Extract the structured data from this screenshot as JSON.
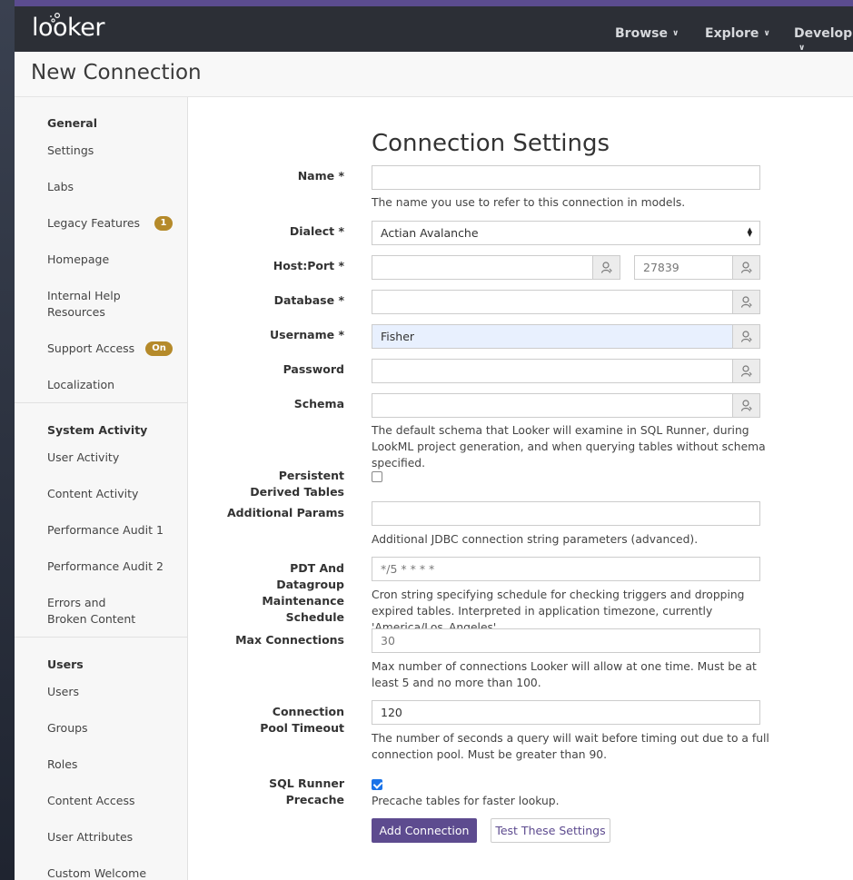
{
  "app": {
    "logo": "looker"
  },
  "nav": {
    "browse": "Browse",
    "explore": "Explore",
    "develop": "Develop"
  },
  "page": {
    "title": "New Connection"
  },
  "sidebar": {
    "general_title": "General",
    "general_items": [
      "Settings",
      "Labs",
      "Legacy Features",
      "Homepage",
      "Internal Help Resources",
      "Support Access",
      "Localization"
    ],
    "legacy_badge": "1",
    "support_badge": "On",
    "system_title": "System Activity",
    "system_items": [
      "User Activity",
      "Content Activity",
      "Performance Audit 1",
      "Performance Audit 2",
      "Errors and Broken Content"
    ],
    "users_title": "Users",
    "users_items": [
      "Users",
      "Groups",
      "Roles",
      "Content Access",
      "User Attributes",
      "Custom Welcome"
    ]
  },
  "form": {
    "title": "Connection Settings",
    "name_label": "Name *",
    "name_help": "The name you use to refer to this connection in models.",
    "dialect_label": "Dialect *",
    "dialect_value": "Actian Avalanche",
    "hostport_label": "Host:Port *",
    "port_value": "27839",
    "database_label": "Database *",
    "username_label": "Username *",
    "username_value": "Fisher",
    "password_label": "Password",
    "schema_label": "Schema",
    "schema_help": "The default schema that Looker will examine in SQL Runner, during LookML project generation, and when querying tables without schema specified.",
    "pdt_label": "Persistent Derived Tables",
    "additional_label": "Additional Params",
    "additional_help": "Additional JDBC connection string parameters (advanced).",
    "maint_label": "PDT And Datagroup Maintenance Schedule",
    "maint_value": "*/5 * * * *",
    "maint_help": "Cron string specifying schedule for checking triggers and dropping expired tables. Interpreted in application timezone, currently 'America/Los_Angeles'",
    "maxconn_label": "Max Connections",
    "maxconn_value": "30",
    "maxconn_help": "Max number of connections Looker will allow at one time. Must be at least 5 and no more than 100.",
    "pool_label": "Connection Pool Timeout",
    "pool_value": "120",
    "pool_help": "The number of seconds a query will wait before timing out due to a full connection pool. Must be greater than 90.",
    "precache_label": "SQL Runner Precache",
    "precache_help": "Precache tables for faster lookup.",
    "add_button": "Add Connection",
    "test_button": "Test These Settings"
  },
  "colors": {
    "accent": "#5d4b8f",
    "navbar": "#2c2f36",
    "badge": "#b58a2a"
  }
}
